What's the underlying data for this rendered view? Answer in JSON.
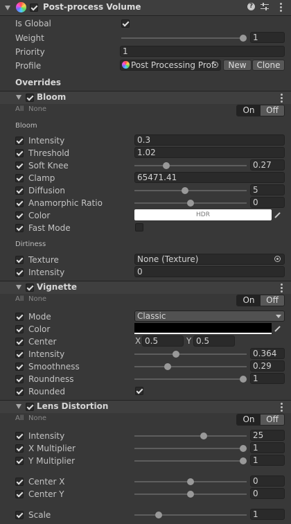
{
  "header": {
    "title": "Post-process Volume",
    "help_icon": "help-icon",
    "settings_icon": "sliders-icon",
    "menu_icon": "kebab-icon"
  },
  "volume": {
    "is_global_label": "Is Global",
    "weight_label": "Weight",
    "weight_value": "1",
    "priority_label": "Priority",
    "priority_value": "1",
    "profile_label": "Profile",
    "profile_value": "Post Processing Prof",
    "new_button": "New",
    "clone_button": "Clone"
  },
  "overrides_label": "Overrides",
  "all_label": "All",
  "none_label": "None",
  "on_label": "On",
  "off_label": "Off",
  "bloom": {
    "title": "Bloom",
    "group_label": "Bloom",
    "rows": [
      {
        "label": "Intensity",
        "value": "0.3"
      },
      {
        "label": "Threshold",
        "value": "1.02"
      },
      {
        "label": "Soft Knee",
        "value": "0.27",
        "slider": 0.27
      },
      {
        "label": "Clamp",
        "value": "65471.41"
      },
      {
        "label": "Diffusion",
        "value": "5",
        "slider": 0.444
      },
      {
        "label": "Anamorphic Ratio",
        "value": "0",
        "slider": 0.5
      },
      {
        "label": "Color",
        "value": "HDR"
      },
      {
        "label": "Fast Mode"
      }
    ],
    "dirtiness_label": "Dirtiness",
    "dirt_rows": [
      {
        "label": "Texture",
        "value": "None (Texture)"
      },
      {
        "label": "Intensity",
        "value": "0"
      }
    ]
  },
  "vignette": {
    "title": "Vignette",
    "rows": [
      {
        "label": "Mode",
        "value": "Classic"
      },
      {
        "label": "Color"
      },
      {
        "label": "Center",
        "x_label": "X",
        "x_value": "0.5",
        "y_label": "Y",
        "y_value": "0.5"
      },
      {
        "label": "Intensity",
        "value": "0.364",
        "slider": 0.364
      },
      {
        "label": "Smoothness",
        "value": "0.29",
        "slider": 0.29
      },
      {
        "label": "Roundness",
        "value": "1",
        "slider": 1
      },
      {
        "label": "Rounded"
      }
    ]
  },
  "lens": {
    "title": "Lens Distortion",
    "rows": [
      {
        "label": "Intensity",
        "value": "25",
        "slider": 0.625
      },
      {
        "label": "X Multiplier",
        "value": "1",
        "slider": 1
      },
      {
        "label": "Y Multiplier",
        "value": "1",
        "slider": 1
      },
      {
        "label": "Center X",
        "value": "0",
        "slider": 0.5
      },
      {
        "label": "Center Y",
        "value": "0",
        "slider": 0.5
      },
      {
        "label": "Scale",
        "value": "1",
        "slider": 0.2
      }
    ]
  }
}
